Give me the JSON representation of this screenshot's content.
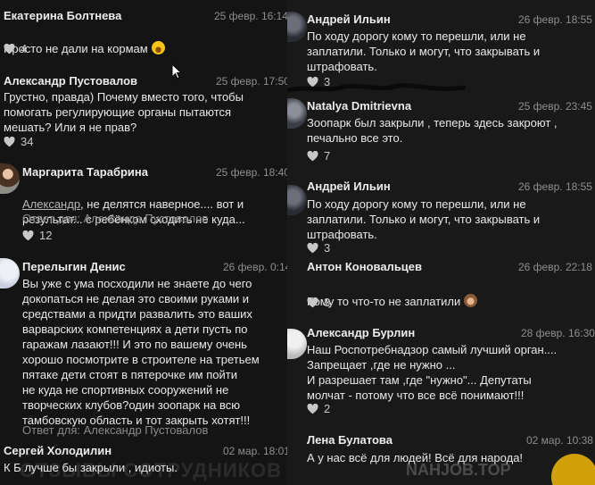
{
  "left": {
    "comments": [
      {
        "author": "Екатерина Болтнева",
        "date": "25 февр. 16:14",
        "text": "Просто не дали на кормам",
        "emoji": "grinning-face-emoji",
        "likes": "4"
      },
      {
        "author": "Александр Пустовалов",
        "date": "25 февр. 17:50",
        "text": "Грустно, правда) Почему вместо того, чтобы\nпомогать регулирующие органы пытаются\nмешать? Или я не прав?",
        "likes": "34"
      },
      {
        "author": "Маргарита Тарабрина",
        "date": "25 февр. 18:40",
        "mention": "Александр",
        "text": ", не делятся наверное.... вот и\nрезультат... с ребёнком сходить не куда...",
        "reply": "Ответ для: Александр Пустовалов",
        "likes": "12"
      },
      {
        "author": "Перелыгин Денис",
        "date": "26 февр. 0:14",
        "text": "Вы уже с ума посходили не знаете до чего\nдокопаться не делая это своими руками и\nсредствами а придти развалить это ваших\nварварских компетенциях а дети пусть по\nгаражам лазают!!! И это по вашему очень\nхорошо посмотрите в строителе на третьем\nпятаке дети стоят в пятерочке им пойти\nне куда не спортивных сооружений не\nтворческих клубов?один зоопарк на всю\nтамбовскую область и тот закрыть хотят!!!",
        "reply": "Ответ для: Александр Пустовалов"
      },
      {
        "author": "Сергей Холодилин",
        "date": "02 мар. 18:01",
        "text": "К Б лучше бы закрыли , идиоты."
      }
    ]
  },
  "right": {
    "comments": [
      {
        "author": "Андрей Ильин",
        "date": "26 февр. 18:55",
        "text": "По ходу дорогу кому то перешли, или не\nзаплатили. Только и могут, что закрывать и\nштрафовать.",
        "likes": "3"
      },
      {
        "author": "Natalya Dmitrievna",
        "date": "25 февр. 23:45",
        "text": "Зоопарк был закрыли , теперь здесь закроют ,\nпечально все это.",
        "likes": "7"
      },
      {
        "author": "Андрей Ильин",
        "date": "26 февр. 18:55",
        "text": "По ходу дорогу кому то перешли, или не\nзаплатили. Только и могут, что закрывать и\nштрафовать.",
        "likes": "3"
      },
      {
        "author": "Антон Коновальцев",
        "date": "26 февр. 22:18",
        "text": "Кому то что-то не заплатили",
        "emoji": "see-no-evil-monkey-emoji",
        "likes": "3"
      },
      {
        "author": "Александр Бурлин",
        "date": "28 февр. 16:30",
        "text": "Наш Роспотребнадзор самый лучший орган....\nЗапрещает ,где не нужно ...\nИ разрешает там ,где \"нужно\"... Депутаты\nмолчат - потому что все всё понимают!!!",
        "likes": "2"
      },
      {
        "author": "Лена Булатова",
        "date": "02 мар. 10:38",
        "text": "А у нас всё для людей! Всё для народа!"
      }
    ]
  },
  "watermark": {
    "left": "ОТЗЫВЫ СОТРУДНИКОВ",
    "right": "NAHJOB.TOP"
  },
  "colors": {
    "bg_left": "#141414",
    "bg_right": "#191919",
    "text": "#e8e8e8",
    "muted": "#8e8e8e"
  }
}
